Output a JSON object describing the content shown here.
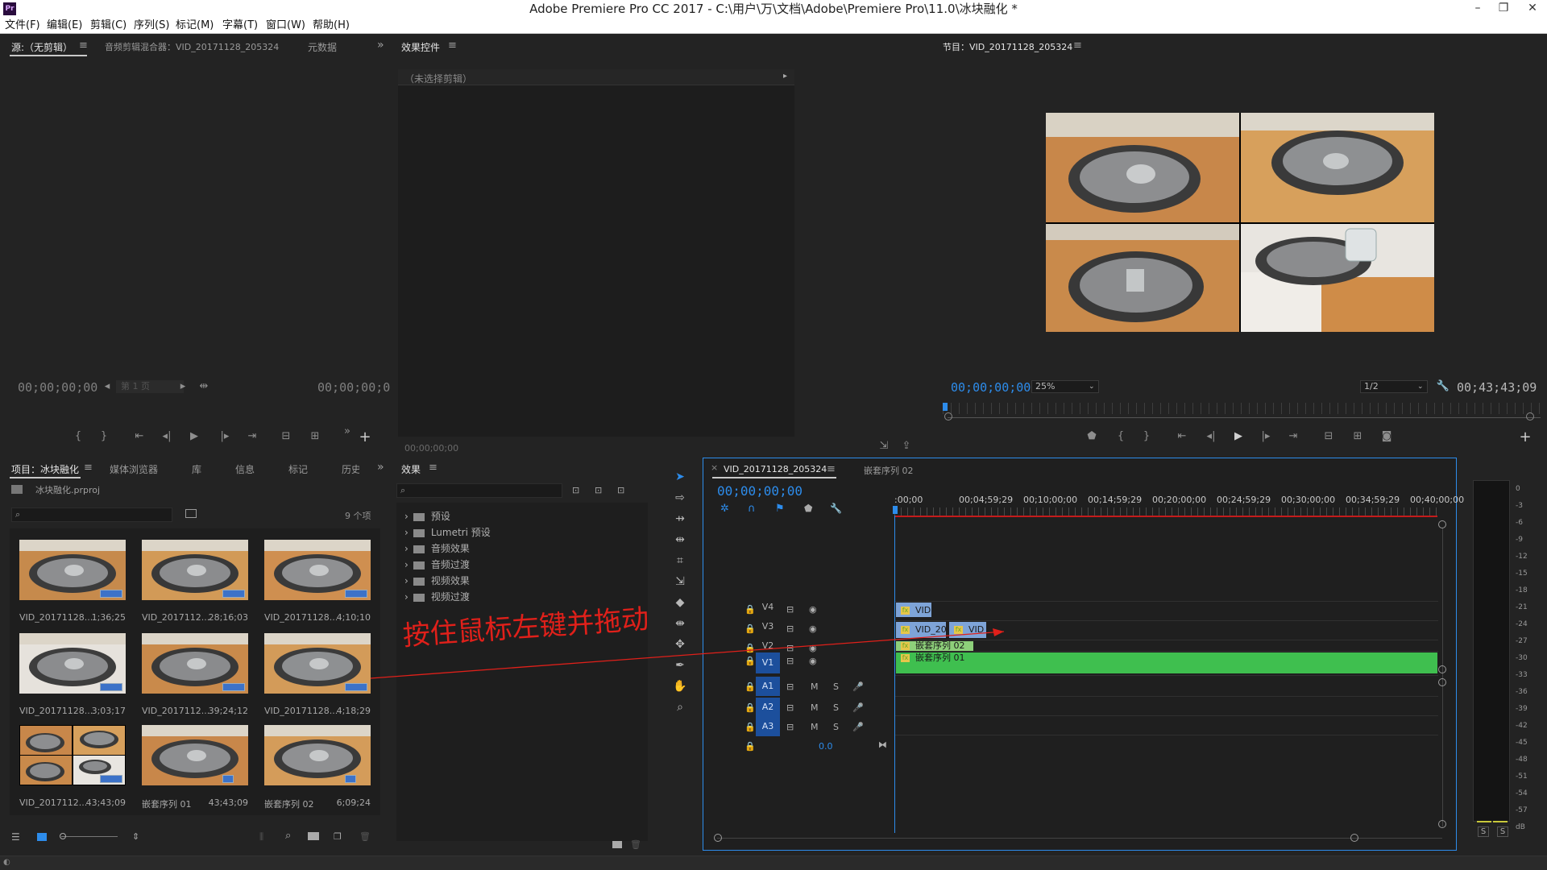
{
  "window": {
    "title": "Adobe Premiere Pro CC 2017 - C:\\用户\\万\\文档\\Adobe\\Premiere Pro\\11.0\\冰块融化 *",
    "app_icon": "Pr",
    "minimize": "–",
    "restore": "❐",
    "close": "✕"
  },
  "menu": [
    "文件(F)",
    "编辑(E)",
    "剪辑(C)",
    "序列(S)",
    "标记(M)",
    "字幕(T)",
    "窗口(W)",
    "帮助(H)"
  ],
  "source_panel": {
    "tabs": [
      "源:（无剪辑）",
      "音频剪辑混合器：VID_20171128_205324",
      "元数据"
    ],
    "timecode_left": "00;00;00;00",
    "timecode_right": "00;00;00;0",
    "page_label": "第 1 页"
  },
  "effect_controls": {
    "tab": "效果控件",
    "no_clip": "（未选择剪辑）",
    "timecode": "00;00;00;00"
  },
  "program_monitor": {
    "tab": "节目：VID_20171128_205324",
    "timecode": "00;00;00;00",
    "zoom": "25%",
    "resolution": "1/2",
    "duration": "00;43;43;09"
  },
  "project_panel": {
    "tabs": [
      "项目：冰块融化",
      "媒体浏览器",
      "库",
      "信息",
      "标记",
      "历史"
    ],
    "file": "冰块融化.prproj",
    "item_count": "9 个项",
    "items": [
      {
        "name": "VID_20171128...",
        "duration": "1;36;25"
      },
      {
        "name": "VID_2017112...",
        "duration": "28;16;03"
      },
      {
        "name": "VID_20171128...",
        "duration": "4;10;10"
      },
      {
        "name": "VID_20171128...",
        "duration": "3;03;17"
      },
      {
        "name": "VID_2017112...",
        "duration": "39;24;12"
      },
      {
        "name": "VID_20171128...",
        "duration": "4;18;29"
      },
      {
        "name": "VID_2017112...",
        "duration": "43;43;09"
      },
      {
        "name": "嵌套序列 01",
        "duration": "43;43;09"
      },
      {
        "name": "嵌套序列 02",
        "duration": "6;09;24"
      }
    ]
  },
  "effects_panel": {
    "tab": "效果",
    "folders": [
      "预设",
      "Lumetri 预设",
      "音频效果",
      "音频过渡",
      "视频效果",
      "视频过渡"
    ]
  },
  "timeline": {
    "tabs": [
      "VID_20171128_205324",
      "嵌套序列 02"
    ],
    "timecode": "00;00;00;00",
    "ruler": [
      ":00;00",
      "00;04;59;29",
      "00;10;00;00",
      "00;14;59;29",
      "00;20;00;00",
      "00;24;59;29",
      "00;30;00;00",
      "00;34;59;29",
      "00;40;00;00"
    ],
    "video_tracks": [
      "V4",
      "V3",
      "V2",
      "V1"
    ],
    "audio_tracks": [
      "A1",
      "A2",
      "A3"
    ],
    "mute": "M",
    "solo": "S",
    "master_level": "0.0",
    "clips": {
      "v4": "VID",
      "v3a": "VID_20",
      "v3b": "VID",
      "v2": "嵌套序列 02",
      "v1": "嵌套序列 01"
    }
  },
  "meter": {
    "labels": [
      "0",
      "-3",
      "-6",
      "-9",
      "-12",
      "-15",
      "-18",
      "-21",
      "-24",
      "-27",
      "-30",
      "-33",
      "-36",
      "-39",
      "-42",
      "-45",
      "-48",
      "-51",
      "-54",
      "-57",
      "dB"
    ],
    "solo_left": "S",
    "solo_right": "S"
  },
  "annotation": {
    "text": "按住鼠标左键并拖动",
    "color": "#e0201a"
  }
}
